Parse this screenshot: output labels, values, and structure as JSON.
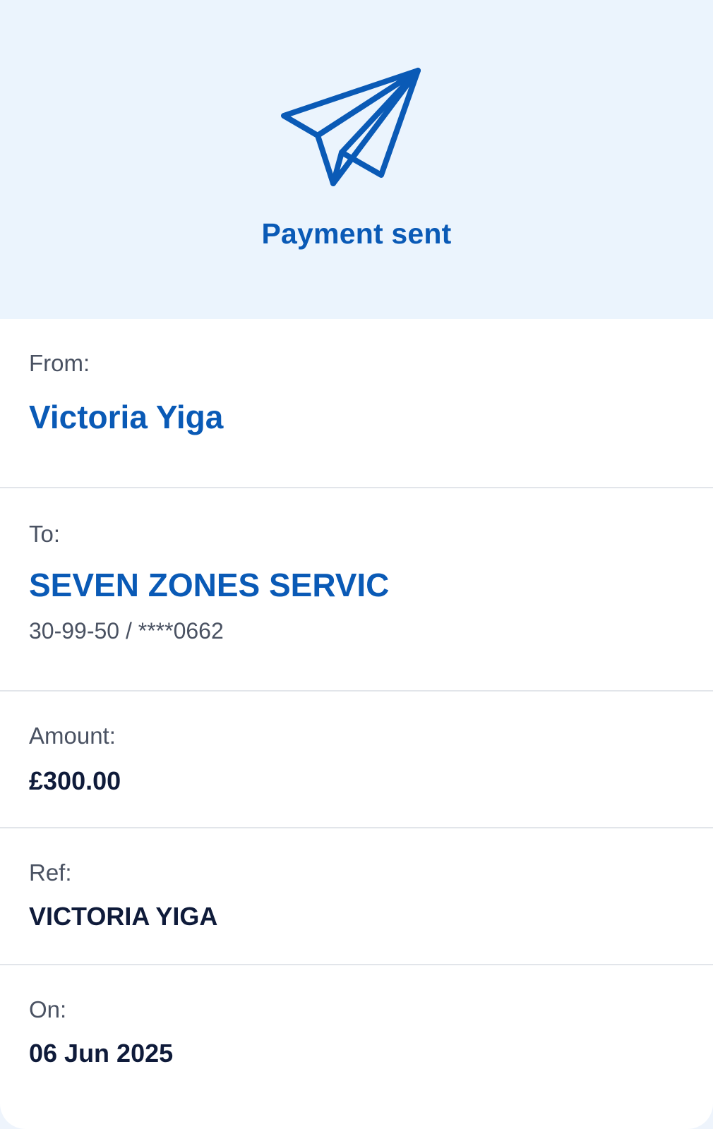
{
  "header": {
    "title": "Payment sent",
    "icon": "paper-plane-icon",
    "accent_color": "#0a5ab6",
    "background_color": "#ebf4fd"
  },
  "from": {
    "label": "From:",
    "name": "Victoria Yiga"
  },
  "to": {
    "label": "To:",
    "name": "SEVEN ZONES SERVIC",
    "account": "30-99-50 / ****0662"
  },
  "amount": {
    "label": "Amount:",
    "value": "£300.00"
  },
  "ref": {
    "label": "Ref:",
    "value": "VICTORIA YIGA"
  },
  "on": {
    "label": "On:",
    "value": "06 Jun 2025"
  }
}
